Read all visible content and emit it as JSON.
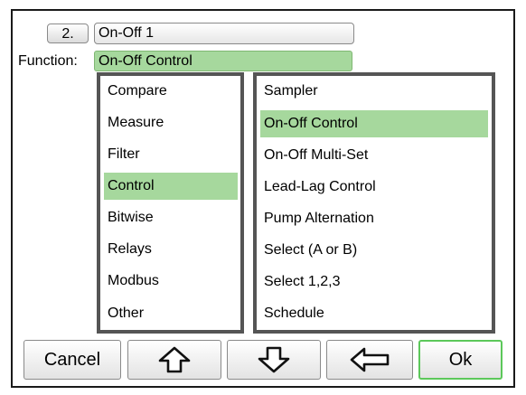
{
  "header": {
    "item_number": "2.",
    "item_name": "On-Off 1"
  },
  "function": {
    "label": "Function:",
    "value": "On-Off Control"
  },
  "categories": {
    "items": [
      "Compare",
      "Measure",
      "Filter",
      "Control",
      "Bitwise",
      "Relays",
      "Modbus",
      "Other"
    ],
    "selected": "Control"
  },
  "functions": {
    "items": [
      "Sampler",
      "On-Off Control",
      "On-Off Multi-Set",
      "Lead-Lag Control",
      "Pump Alternation",
      "Select (A or B)",
      "Select 1,2,3",
      "Schedule"
    ],
    "selected": "On-Off Control"
  },
  "buttons": {
    "cancel_label": "Cancel",
    "up_icon": "arrow-up-icon",
    "down_icon": "arrow-down-icon",
    "back_icon": "arrow-left-icon",
    "ok_label": "Ok"
  },
  "colors": {
    "selection": "#a6d89d",
    "ok_border": "#5cc85a",
    "list_border": "#555555"
  }
}
